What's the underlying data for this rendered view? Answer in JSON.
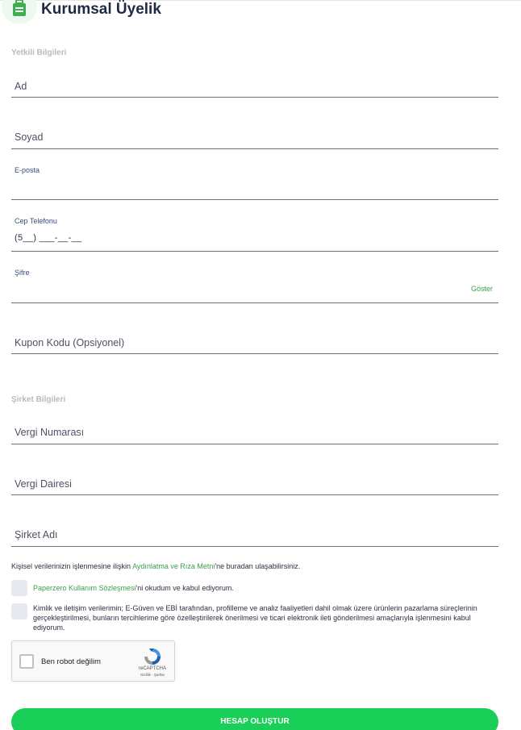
{
  "header": {
    "title": "Kurumsal Üyelik",
    "icon": "briefcase-icon"
  },
  "sections": {
    "authorized": "Yetkili Bilgileri",
    "company": "Şirket Bilgileri"
  },
  "fields": {
    "first_name": {
      "placeholder": "Ad"
    },
    "last_name": {
      "placeholder": "Soyad"
    },
    "email": {
      "label": "E-posta",
      "value": ""
    },
    "phone": {
      "label": "Cep Telefonu",
      "value": "(5__) ___-__-__"
    },
    "password": {
      "label": "Şifre",
      "show_label": "Göster"
    },
    "coupon": {
      "placeholder": "Kupon Kodu (Opsiyonel)"
    },
    "tax_number": {
      "placeholder": "Vergi Numarası"
    },
    "tax_office": {
      "placeholder": "Vergi Dairesi"
    },
    "company_name": {
      "placeholder": "Şirket Adı"
    }
  },
  "info": {
    "prefix": "Kişisel verilerinizin işlenmesine ilişkin ",
    "link": "Aydınlatma ve Rıza Metni",
    "suffix": "'ne buradan ulaşabilirsiniz."
  },
  "consents": {
    "terms_link": "Paperzero Kullanım Sözleşmesi",
    "terms_suffix": "'ni okudum ve kabul ediyorum.",
    "marketing": "Kimlik ve iletişim verilerimin; E-Güven ve EBİ tarafından, profilleme ve analiz faaliyetleri dahil olmak üzere ürünlerin pazarlama süreçlerinin gerçekleştirilmesi, bunların tercihlerime göre özelleştirilerek önerilmesi ve ticari elektronik ileti gönderilmesi amaçlarıyla işlenmesini kabul ediyorum."
  },
  "captcha": {
    "label": "Ben robot değilim",
    "brand": "reCAPTCHA",
    "links": "Gizlilik - Şartlar"
  },
  "submit": {
    "label": "HESAP OLUŞTUR"
  },
  "colors": {
    "accent_green": "#19cf57",
    "link_green": "#3a9d49",
    "title_navy": "#1f2a44"
  }
}
